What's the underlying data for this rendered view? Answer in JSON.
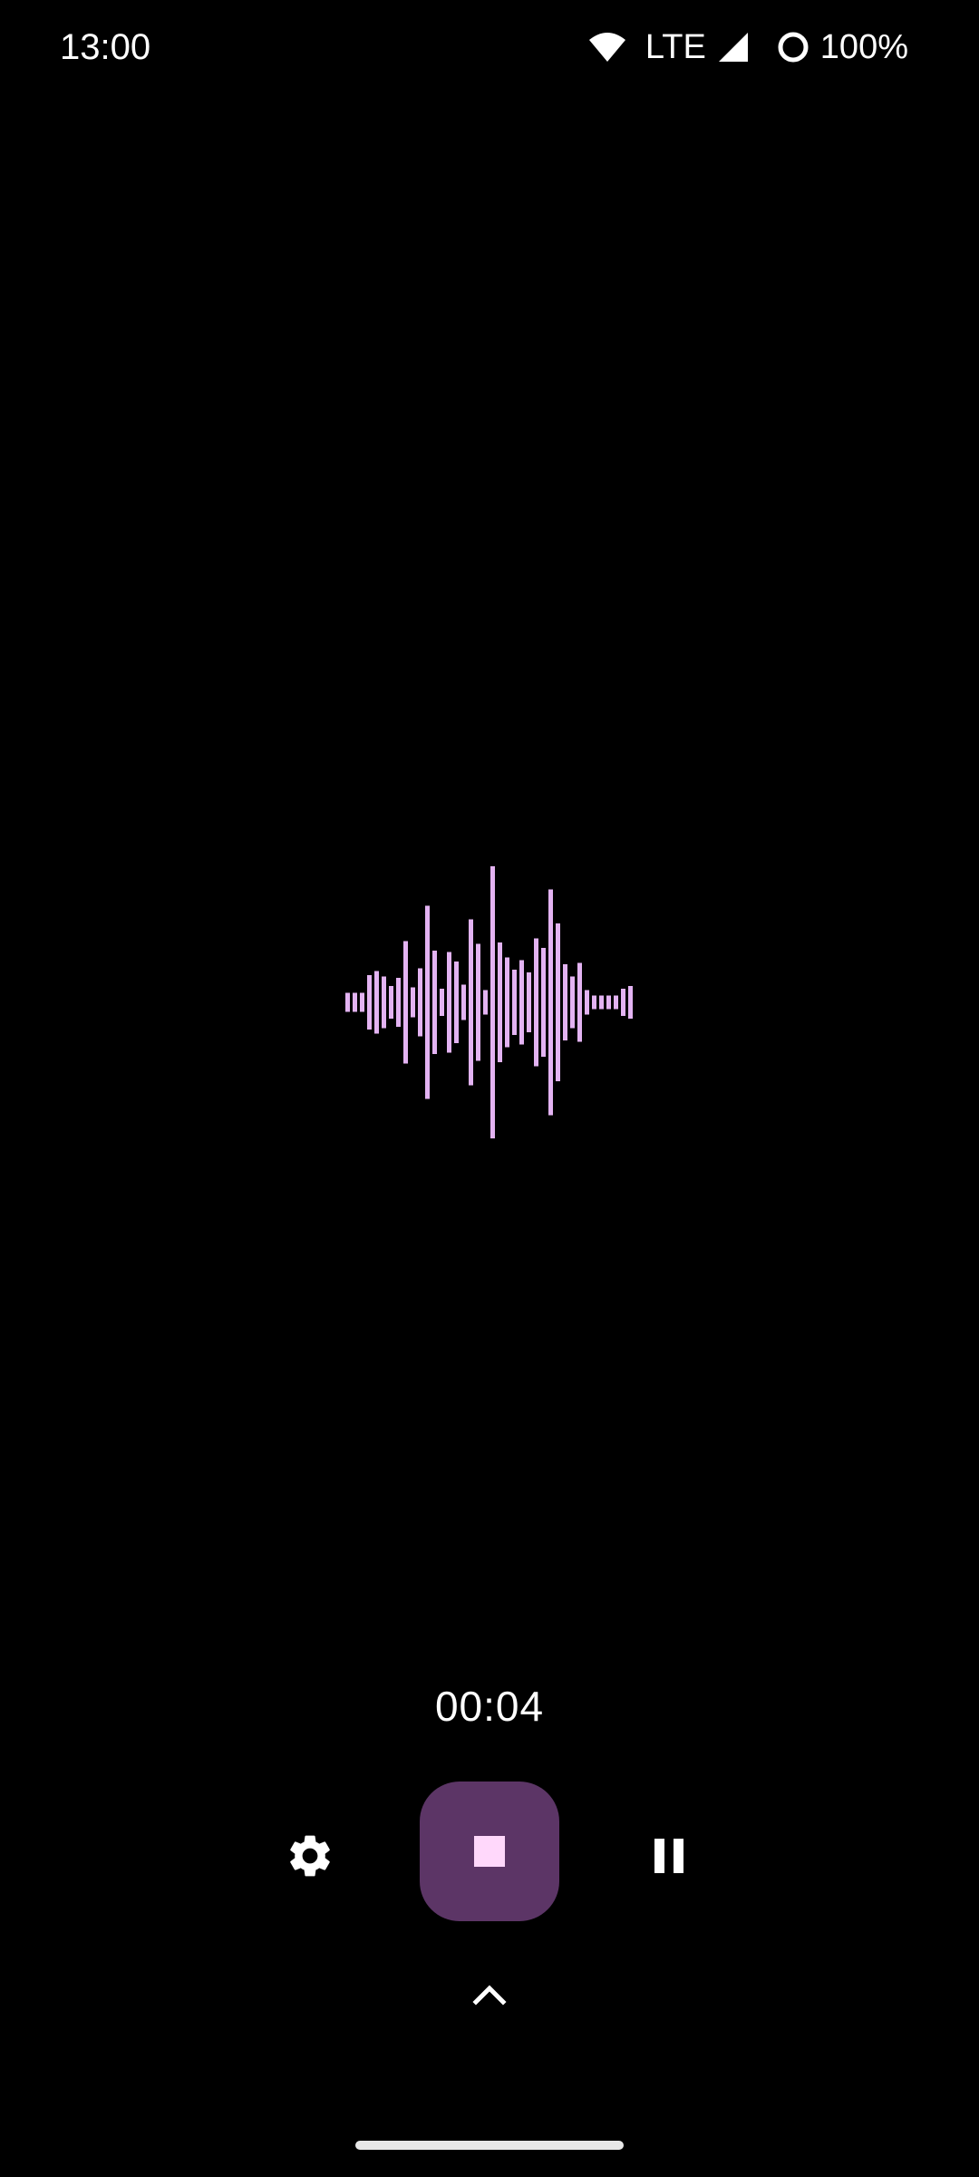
{
  "status_bar": {
    "time": "13:00",
    "network": "LTE",
    "battery": "100%",
    "icons": [
      "wifi-icon",
      "cell-signal-icon",
      "battery-saver-ring-icon"
    ]
  },
  "recorder": {
    "timer": "00:04",
    "waveform_color": "#e3b3f2",
    "waveform_levels": [
      0.07,
      0.07,
      0.07,
      0.2,
      0.23,
      0.19,
      0.12,
      0.18,
      0.45,
      0.11,
      0.25,
      0.71,
      0.38,
      0.1,
      0.37,
      0.3,
      0.13,
      0.61,
      0.43,
      0.09,
      1.0,
      0.44,
      0.33,
      0.24,
      0.31,
      0.22,
      0.47,
      0.4,
      0.83,
      0.58,
      0.28,
      0.19,
      0.29,
      0.09,
      0.05,
      0.05,
      0.05,
      0.05,
      0.1,
      0.12
    ],
    "icons": {
      "settings": "gear-icon",
      "stop": "stop-icon",
      "pause": "pause-icon",
      "expand": "chevron-up-icon"
    },
    "colors": {
      "background": "#000000",
      "stop_button_bg": "#5c3566",
      "stop_icon": "#ffd8fb",
      "icon_foreground": "#ffffff"
    }
  }
}
